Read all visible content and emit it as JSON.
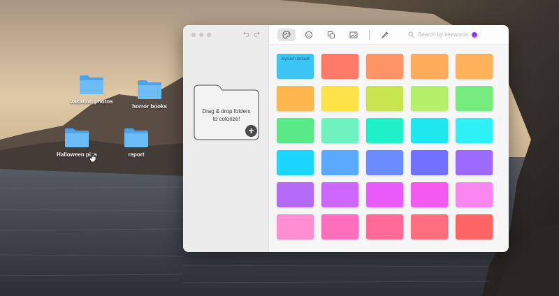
{
  "desktop": {
    "icons": [
      {
        "label": "vacation photos",
        "color": "#5fb4ef"
      },
      {
        "label": "horror books",
        "color": "#5fb4ef"
      },
      {
        "label": "Halloween pics",
        "color": "#5fb4ef"
      },
      {
        "label": "report",
        "color": "#5fb4ef"
      }
    ]
  },
  "app": {
    "toolbar": {
      "icons": [
        "palette-icon",
        "emoji-icon",
        "shapes-icon",
        "image-icon",
        "eyedropper-icon"
      ],
      "search_placeholder": "Search by keywords"
    },
    "sidebar": {
      "drop_line1": "Drag & drop folders",
      "drop_line2": "to colorize!",
      "add_symbol": "+"
    },
    "swatches": [
      {
        "color": "#3cc4f5",
        "label": "System default"
      },
      {
        "color": "#ff7a66",
        "label": ""
      },
      {
        "color": "#ff9466",
        "label": ""
      },
      {
        "color": "#ffab5c",
        "label": ""
      },
      {
        "color": "#ffb25a",
        "label": ""
      },
      {
        "color": "#ffb74d",
        "label": ""
      },
      {
        "color": "#fde249",
        "label": ""
      },
      {
        "color": "#c6e54f",
        "label": ""
      },
      {
        "color": "#b5f06a",
        "label": ""
      },
      {
        "color": "#77ec7e",
        "label": ""
      },
      {
        "color": "#5be987",
        "label": ""
      },
      {
        "color": "#6ff2c0",
        "label": ""
      },
      {
        "color": "#1ff0c7",
        "label": ""
      },
      {
        "color": "#1ee8ee",
        "label": ""
      },
      {
        "color": "#2ef0f7",
        "label": ""
      },
      {
        "color": "#1cd6ff",
        "label": ""
      },
      {
        "color": "#5aa8ff",
        "label": ""
      },
      {
        "color": "#6a8cff",
        "label": ""
      },
      {
        "color": "#7271ff",
        "label": ""
      },
      {
        "color": "#9b6bff",
        "label": ""
      },
      {
        "color": "#b46af5",
        "label": ""
      },
      {
        "color": "#cd66fb",
        "label": ""
      },
      {
        "color": "#ea5bfb",
        "label": ""
      },
      {
        "color": "#f55af0",
        "label": ""
      },
      {
        "color": "#fa86ef",
        "label": ""
      },
      {
        "color": "#ff8ed3",
        "label": ""
      },
      {
        "color": "#ff6dbd",
        "label": ""
      },
      {
        "color": "#ff6a99",
        "label": ""
      },
      {
        "color": "#ff6e7f",
        "label": ""
      },
      {
        "color": "#ff6565",
        "label": ""
      }
    ]
  }
}
